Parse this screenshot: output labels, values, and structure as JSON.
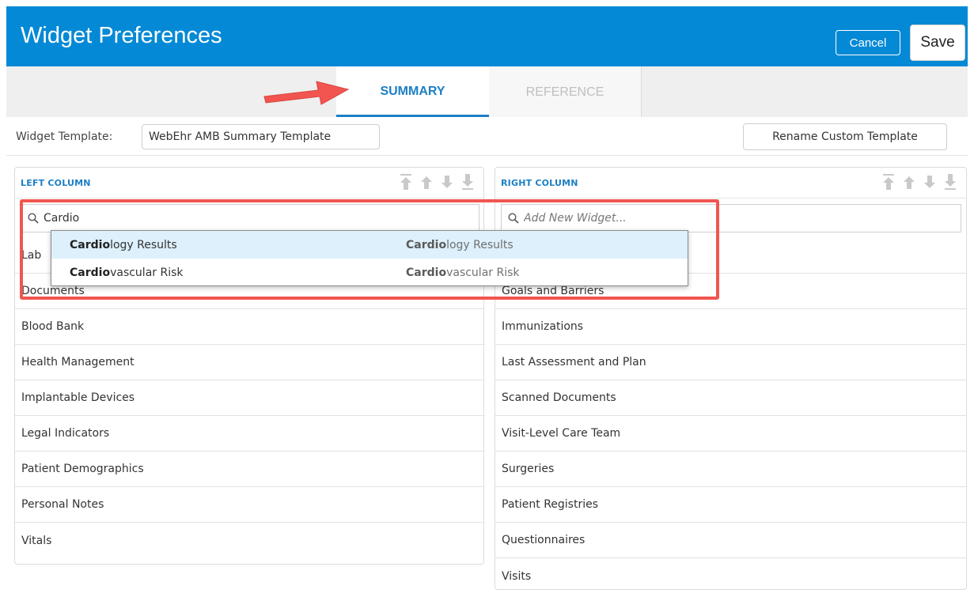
{
  "header": {
    "title": "Widget Preferences",
    "cancel_label": "Cancel",
    "save_label": "Save"
  },
  "tabs": [
    {
      "label": "SUMMARY",
      "active": true
    },
    {
      "label": "REFERENCE",
      "active": false
    }
  ],
  "template": {
    "label": "Widget Template:",
    "value": "WebEhr AMB Summary Template",
    "rename_label": "Rename Custom Template"
  },
  "left_column": {
    "title": "LEFT COLUMN",
    "search_value": "Cardio",
    "items": [
      "Lab",
      "Documents",
      "Blood Bank",
      "Health Management",
      "Implantable Devices",
      "Legal Indicators",
      "Patient Demographics",
      "Personal Notes",
      "Vitals"
    ]
  },
  "right_column": {
    "title": "RIGHT COLUMN",
    "search_placeholder": "Add New Widget...",
    "items": [
      "",
      "Goals and Barriers",
      "Immunizations",
      "Last Assessment and Plan",
      "Scanned Documents",
      "Visit-Level Care Team",
      "Surgeries",
      "Patient Registries",
      "Questionnaires",
      "Visits"
    ]
  },
  "autocomplete": {
    "match": "Cardio",
    "results": [
      {
        "left_bold": "Cardio",
        "left_rest": "logy Results",
        "right_bold": "Cardio",
        "right_rest": "logy Results"
      },
      {
        "left_bold": "Cardio",
        "left_rest": "vascular Risk",
        "right_bold": "Cardio",
        "right_rest": "vascular Risk"
      }
    ]
  },
  "colors": {
    "header_bg": "#0489d6",
    "accent": "#1c7fc4",
    "annotation": "#f2554f",
    "dropdown_highlight": "#ddf0fb"
  },
  "icons": {
    "reorder": [
      "move-to-top-icon",
      "move-up-icon",
      "move-down-icon",
      "move-to-bottom-icon"
    ],
    "search": "search-icon",
    "annotation": "red-arrow-icon"
  }
}
